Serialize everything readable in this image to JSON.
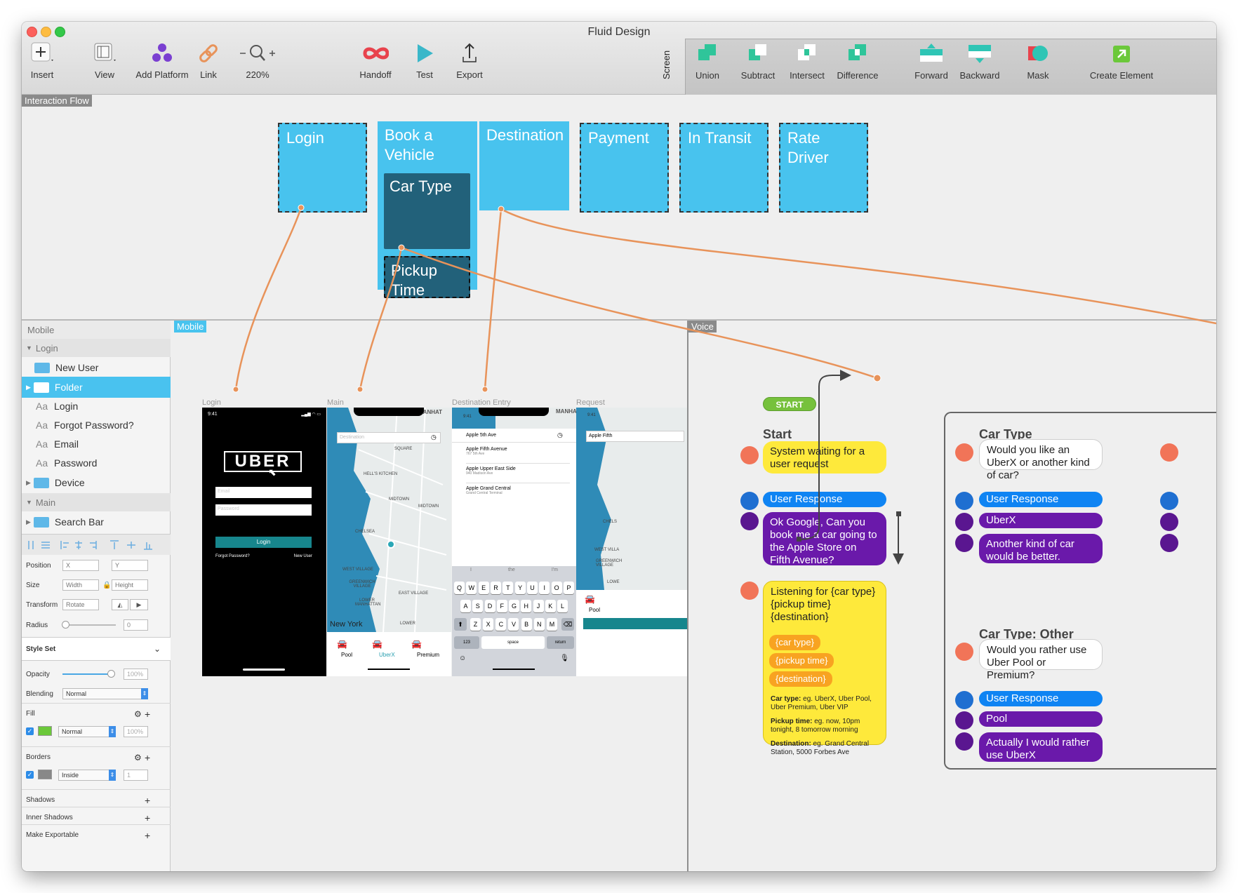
{
  "window": {
    "title": "Fluid Design"
  },
  "toolbar": {
    "insert": "Insert",
    "view": "View",
    "add_platform": "Add Platform",
    "link": "Link",
    "zoom": "220%",
    "handoff": "Handoff",
    "test": "Test",
    "export": "Export",
    "screen": "Screen",
    "union": "Union",
    "subtract": "Subtract",
    "intersect": "Intersect",
    "difference": "Difference",
    "forward": "Forward",
    "backward": "Backward",
    "mask": "Mask",
    "create_element": "Create Element"
  },
  "colors": {
    "accent": "#48c3ee",
    "dark_card": "#22617a",
    "wire": "#e8935a",
    "yellow": "#fee93b",
    "blue": "#0f84f3",
    "purple": "#6a19aa",
    "green": "#6bc83a"
  },
  "flow": {
    "tag": "Interaction Flow",
    "cards": {
      "login": "Login",
      "book": "Book a Vehicle",
      "car_type": "Car Type",
      "pickup": "Pickup Time",
      "destination": "Destination",
      "payment": "Payment",
      "in_transit": "In Transit",
      "rate_driver": "Rate Driver"
    }
  },
  "sidebar": {
    "section": "Mobile",
    "login_group": "Login",
    "items": {
      "new_user": "New User",
      "folder": "Folder",
      "login": "Login",
      "forgot": "Forgot Password?",
      "email": "Email",
      "password": "Password",
      "device": "Device"
    },
    "main_group": "Main",
    "search_bar": "Search Bar",
    "aa": "Aa"
  },
  "props": {
    "position": "Position",
    "x": "X",
    "y": "Y",
    "size": "Size",
    "width": "Width",
    "height": "Height",
    "transform": "Transform",
    "rotate": "Rotate",
    "radius": "Radius",
    "radius_val": "0",
    "style_set": "Style Set",
    "opacity": "Opacity",
    "opacity_val": "100%",
    "blending": "Blending",
    "blending_val": "Normal",
    "fill": "Fill",
    "fill_mode": "Normal",
    "fill_opacity": "100%",
    "borders": "Borders",
    "border_pos": "Inside",
    "border_width": "1",
    "shadows": "Shadows",
    "inner_shadows": "Inner Shadows",
    "make_exportable": "Make Exportable"
  },
  "mobile": {
    "tag": "Mobile",
    "labels": {
      "login": "Login",
      "main": "Main",
      "destination": "Destination Entry",
      "request": "Request"
    },
    "login_screen": {
      "time": "9:41",
      "logo": "UBER",
      "email": "Email",
      "password": "Password",
      "button": "Login",
      "forgot": "Forgot Password?",
      "new_user": "New User"
    },
    "main_screen": {
      "placeholder": "Destination",
      "options": [
        "Pool",
        "UberX",
        "Premium"
      ],
      "map_labels": [
        "MANHAT",
        "SQUARE",
        "HELL'S KITCHEN",
        "MIDTOWN",
        "MIDTOWN",
        "CHELSEA",
        "WEST VILLAGE",
        "GREENWICH VILLAGE",
        "EAST VILLAGE",
        "LOWER MANHATTAN",
        "LOWER",
        "New York"
      ]
    },
    "dest_screen": {
      "time": "9:41",
      "query": "Apple 5th Ave",
      "results": [
        {
          "name": "Apple Fifth Avenue",
          "addr": "767 5th Ave"
        },
        {
          "name": "Apple Upper East Side",
          "addr": "940 Madison Ave"
        },
        {
          "name": "Apple Grand Central",
          "addr": "Grand Central Terminal"
        }
      ],
      "suggest": [
        "I",
        "the",
        "I'm"
      ],
      "row1": [
        "Q",
        "W",
        "E",
        "R",
        "T",
        "Y",
        "U",
        "I",
        "O",
        "P"
      ],
      "row2": [
        "A",
        "S",
        "D",
        "F",
        "G",
        "H",
        "J",
        "K",
        "L"
      ],
      "row3": [
        "Z",
        "X",
        "C",
        "V",
        "B",
        "N",
        "M"
      ],
      "k123": "123",
      "space": "space",
      "return": "return",
      "map_label": "MANHAT"
    },
    "req_screen": {
      "time": "9:41",
      "query": "Apple Fifth",
      "pool": "Pool",
      "map_labels": [
        "CHELS",
        "WEST VILLA",
        "GREENWICH VILLAGE",
        "LOWE"
      ]
    }
  },
  "voice": {
    "tag": "Voice",
    "start_pill": "START",
    "start_head": "Start",
    "waiting": "System waiting for a user request",
    "user_response": "User Response",
    "ok_google": "Ok Google, Can you book me a car going to the Apple Store on Fifth Avenue?",
    "listening": "Listening for {car type} {pickup time} {destination}",
    "chips": [
      "{car type}",
      "{pickup time}",
      "{destination}"
    ],
    "notes": [
      {
        "k": "Car type:",
        "v": " eg. UberX, Uber Pool, Uber Premium, Uber VIP"
      },
      {
        "k": "Pickup time:",
        "v": " eg. now, 10pm tonight, 8 tomorrow morning"
      },
      {
        "k": "Destination:",
        "v": " eg. Grand Central Station, 5000 Forbes Ave"
      }
    ],
    "car_type_head": "Car Type",
    "car_type_q": "Would you like an UberX or another kind of car?",
    "uberx": "UberX",
    "another": "Another kind of car would be better.",
    "other_head": "Car Type: Other",
    "other_q": "Would you rather use Uber Pool or Premium?",
    "pool": "Pool",
    "rather": "Actually I would rather use UberX"
  }
}
